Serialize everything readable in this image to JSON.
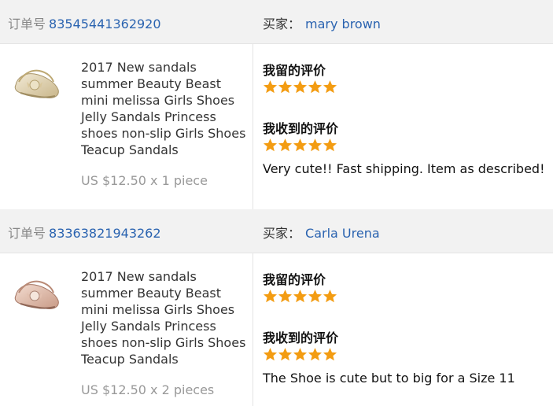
{
  "labels": {
    "order_no": "订单号",
    "buyer": "买家：",
    "my_feedback": "我留的评价",
    "received_feedback": "我收到的评价"
  },
  "colors": {
    "link": "#2a63b0",
    "star": "#f39c12",
    "header_bg": "#f2f2f2"
  },
  "orders": [
    {
      "order_number": "83545441362920",
      "buyer_name": "mary brown",
      "product": {
        "title": "2017 New sandals summer Beauty Beast mini melissa Girls Shoes Jelly Sandals Princess shoes non-slip Girls Shoes Teacup Sandals",
        "price": "US $12.50 x 1 piece",
        "thumb_icon": "gold-sandal-thumbnail"
      },
      "my_rating": 5,
      "received_rating": 5,
      "received_comment": "Very cute!! Fast shipping. Item as described!"
    },
    {
      "order_number": "83363821943262",
      "buyer_name": "Carla Urena",
      "product": {
        "title": "2017 New sandals summer Beauty Beast mini melissa Girls Shoes Jelly Sandals Princess shoes non-slip Girls Shoes Teacup Sandals",
        "price": "US $12.50 x 2 pieces",
        "thumb_icon": "pink-sandal-thumbnail"
      },
      "my_rating": 5,
      "received_rating": 5,
      "received_comment": "The Shoe is cute but to big for a Size 11"
    }
  ]
}
